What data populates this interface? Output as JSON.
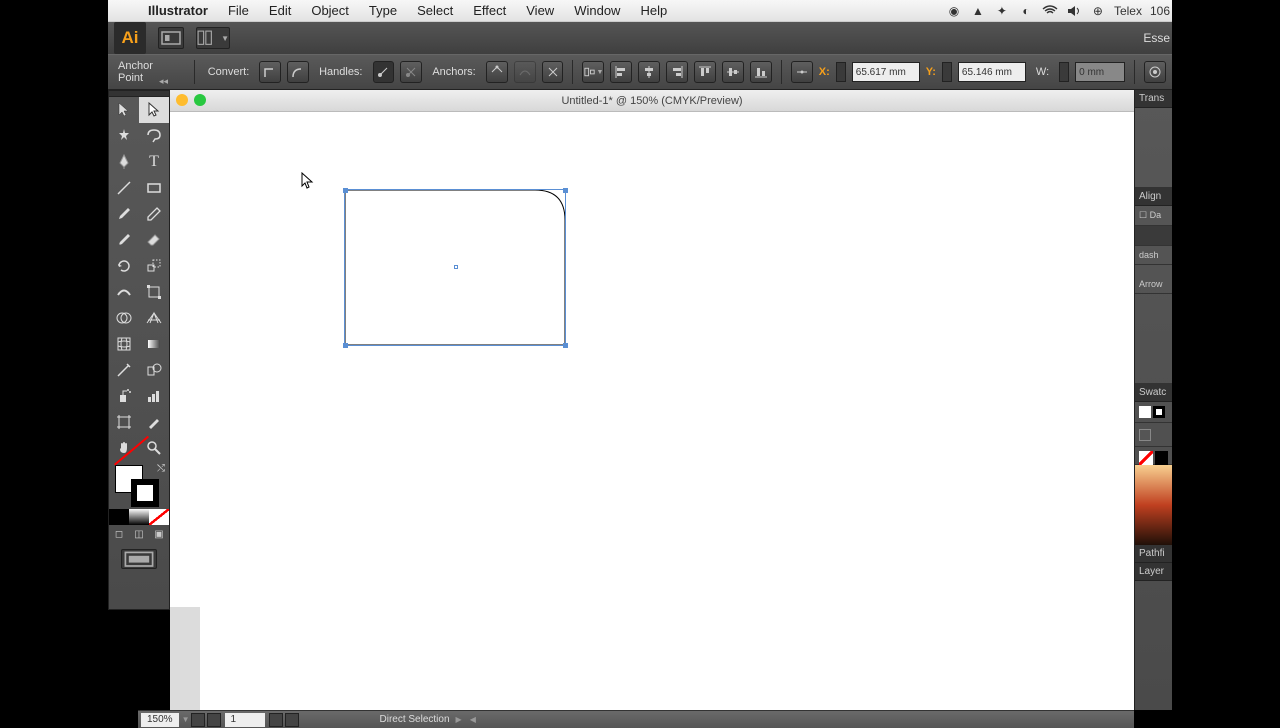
{
  "menubar": {
    "apple": "",
    "appname": "Illustrator",
    "items": [
      "File",
      "Edit",
      "Object",
      "Type",
      "Select",
      "Effect",
      "View",
      "Window",
      "Help"
    ],
    "right": {
      "input": "Telex",
      "pct": "106"
    }
  },
  "header": {
    "logo": "Ai",
    "workspace": "Esse"
  },
  "controlbar": {
    "mode_label": "Anchor Point",
    "convert_label": "Convert:",
    "handles_label": "Handles:",
    "anchors_label": "Anchors:",
    "x_label": "X:",
    "y_label": "Y:",
    "w_label": "W:",
    "x_value": "65.617 mm",
    "y_value": "65.146 mm",
    "w_value": "0 mm"
  },
  "document": {
    "title": "Untitled-1* @ 150% (CMYK/Preview)"
  },
  "statusbar": {
    "zoom": "150%",
    "page": "1",
    "tool": "Direct Selection"
  },
  "rightpanel": {
    "transform": "Trans",
    "align": "Align",
    "da": "Da",
    "dash": "dash",
    "arrow": "Arrow",
    "swatch": "Swatc",
    "pathfi": "Pathfi",
    "layer": "Layer"
  }
}
